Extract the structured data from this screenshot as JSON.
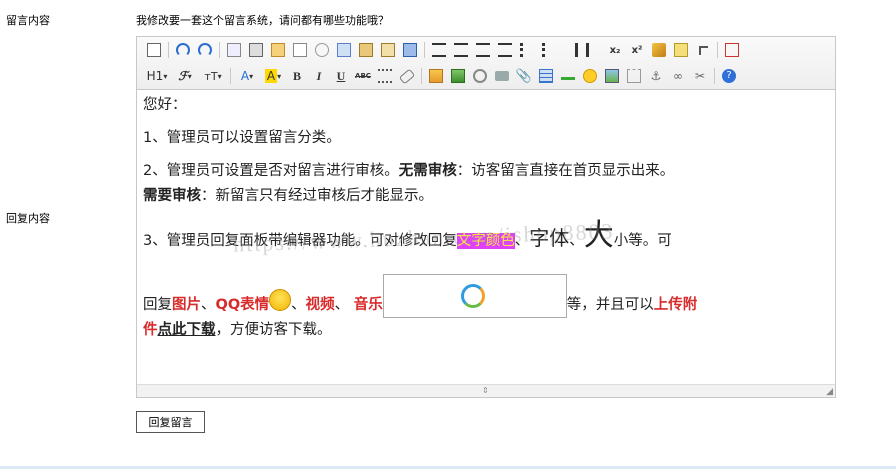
{
  "form": {
    "message_label": "留言内容",
    "message_text": "我修改要一套这个留言系统，请问都有哪些功能哦？",
    "reply_label": "回复内容",
    "submit_label": "回复留言"
  },
  "toolbar": {
    "row1": [
      "source-icon",
      "undo-icon",
      "redo-icon",
      "preview-icon",
      "print-icon",
      "template-icon",
      "code-icon",
      "cut-icon",
      "copy-icon",
      "paste-icon",
      "paste-text-icon",
      "paste-word-icon",
      "align-left-icon",
      "align-center-icon",
      "align-right-icon",
      "justify-icon",
      "ordered-list-icon",
      "unordered-list-icon",
      "indent-icon",
      "outdent-icon",
      "subscript-icon",
      "superscript-icon",
      "clear-format-icon",
      "spellcheck-icon",
      "select-all-icon",
      "fullscreen-icon"
    ],
    "heading_label": "H1",
    "font_label": "ℱ",
    "size_label": "тT",
    "forecolor_label": "A",
    "backcolor_label": "A",
    "bold_label": "B",
    "italic_label": "I",
    "underline_label": "U",
    "strike_label": "ABC"
  },
  "content": {
    "greeting": "您好：",
    "line1": "1、管理员可以设置留言分类。",
    "line2_a": "2、管理员可设置是否对留言进行审核。",
    "line2_b": "无需审核",
    "line2_c": "：访客留言直接在首页显示出来。",
    "line2_d": "需要审核",
    "line2_e": "：新留言只有经过审核后才能显示。",
    "line3_a": "3、管理员回复面板带编辑器功能。可对修改回复",
    "line3_b": "文字颜色",
    "line3_c": "、",
    "line3_d": "字体",
    "line3_e": "、",
    "line3_f": "大",
    "line3_g": "小等。可",
    "line4_a": "回复",
    "line4_b": "图片",
    "line4_c": "、",
    "line4_d": "QQ表情",
    "line4_e": "、",
    "line4_f": "视频",
    "line4_g": "、  ",
    "line4_h": "音乐",
    "line4_i": "等，并且可以",
    "line4_j": "上传附",
    "line5_a": "件",
    "line5_b": "点此下载",
    "line5_c": "，方便访客下载。"
  },
  "watermark": "https://www.huzhan.com/ishop8803",
  "colors": {
    "red": "#d92b2b",
    "highlight_bg": "#e040fb",
    "highlight_fg": "#ffeb3b"
  }
}
